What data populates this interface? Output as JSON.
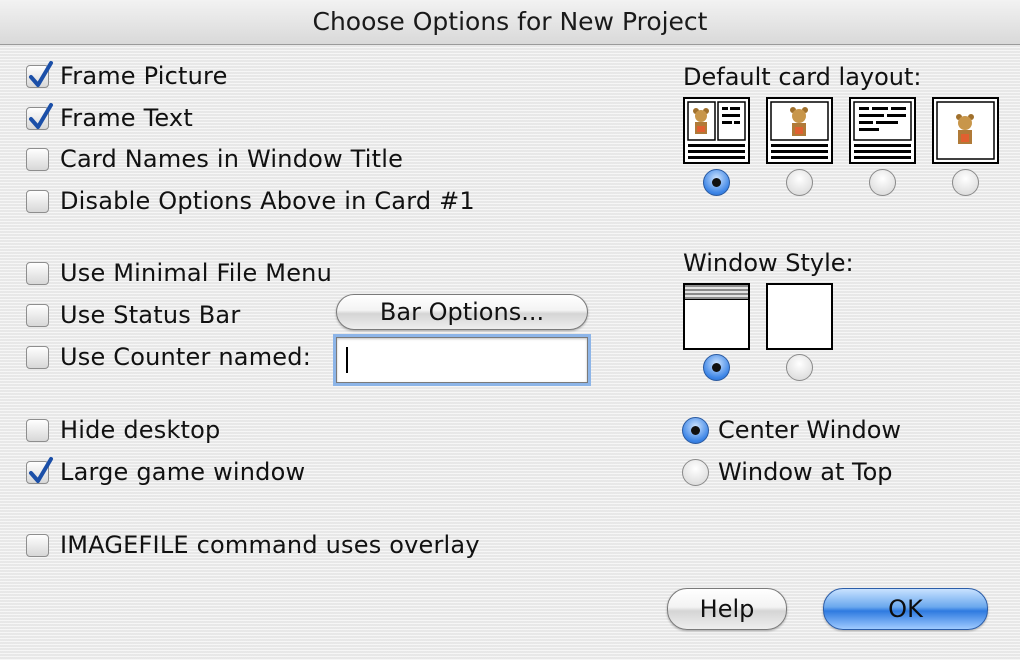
{
  "window": {
    "title": "Choose Options for New Project"
  },
  "options_group1": [
    {
      "label": "Frame Picture",
      "checked": true
    },
    {
      "label": "Frame Text",
      "checked": true
    },
    {
      "label": "Card Names in Window Title",
      "checked": false
    },
    {
      "label": "Disable Options Above in Card #1",
      "checked": false
    }
  ],
  "options_group2": [
    {
      "label": "Use Minimal File Menu",
      "checked": false
    },
    {
      "label": "Use Status Bar",
      "checked": false
    },
    {
      "label": "Use Counter named:",
      "checked": false
    }
  ],
  "bar_options_button": "Bar Options...",
  "counter_name": {
    "value": "",
    "placeholder": ""
  },
  "options_group3": [
    {
      "label": "Hide desktop",
      "checked": false
    },
    {
      "label": "Large game window",
      "checked": true
    }
  ],
  "options_group4": [
    {
      "label": "IMAGEFILE command uses overlay",
      "checked": false
    }
  ],
  "card_layout": {
    "heading": "Default card layout:",
    "options": [
      "picture-and-text",
      "picture-only",
      "text-only",
      "picture-no-bar"
    ],
    "selected_index": 0
  },
  "window_style": {
    "heading": "Window Style:",
    "options": [
      "title-bar",
      "plain"
    ],
    "selected_index": 0
  },
  "window_position": {
    "options": [
      {
        "label": "Center Window",
        "selected": true
      },
      {
        "label": "Window at Top",
        "selected": false
      }
    ]
  },
  "buttons": {
    "help": "Help",
    "ok": "OK"
  },
  "colors": {
    "accent": "#3b84e6",
    "default_button": "#2e7ae0",
    "focus_ring": "#8db5e8"
  }
}
